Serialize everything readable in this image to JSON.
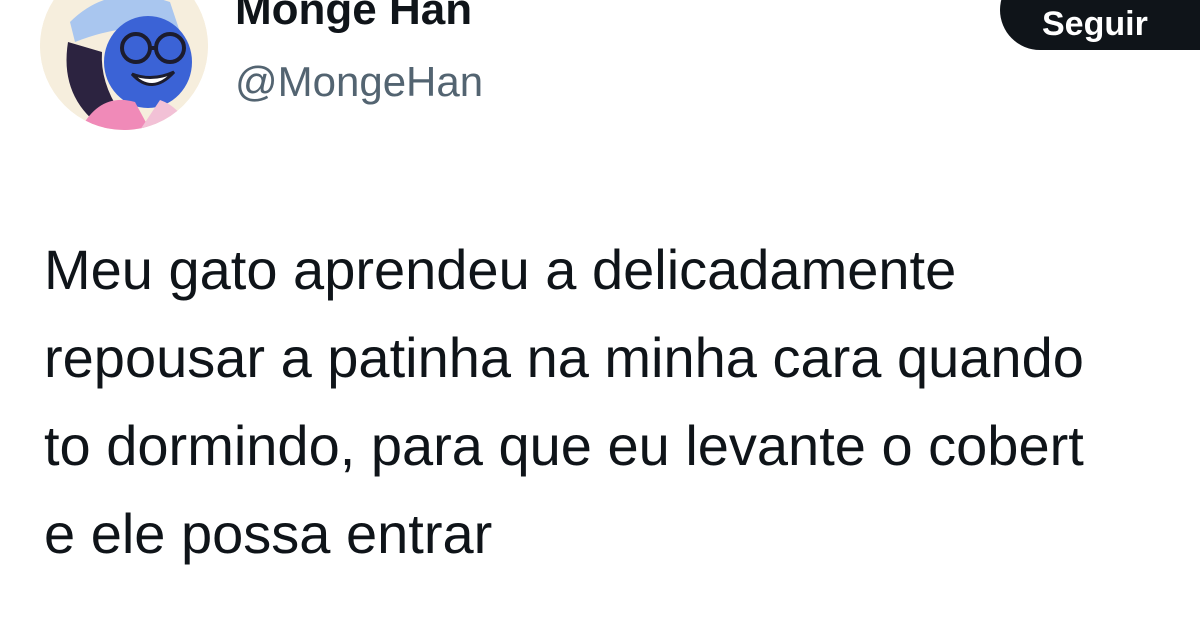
{
  "author": {
    "display_name": "Monge Han",
    "handle": "@MongeHan",
    "avatar_icon": "cartoon-avatar-icon"
  },
  "actions": {
    "follow_label": "Seguir"
  },
  "tweet": {
    "lines": [
      "Meu gato aprendeu a delicadamente",
      "repousar a patinha na minha cara quando",
      "to dormindo, para que eu levante o cobert",
      "e ele possa entrar"
    ]
  },
  "colors": {
    "text_primary": "#0f1419",
    "text_secondary": "#536471",
    "button_bg": "#0f1419",
    "button_text": "#ffffff",
    "background": "#ffffff"
  }
}
